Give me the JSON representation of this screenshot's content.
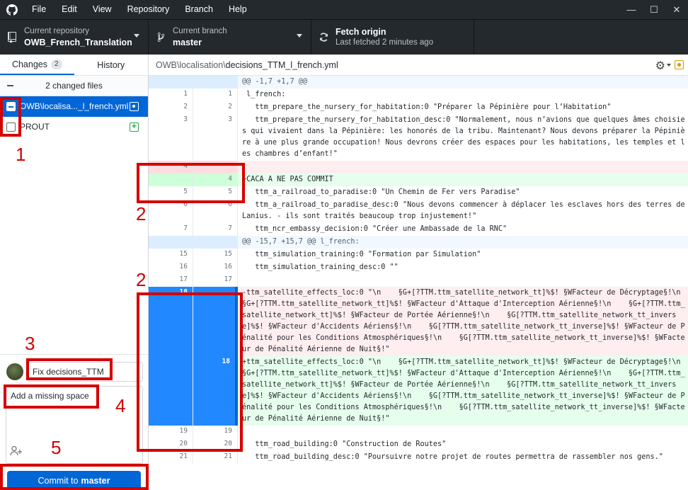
{
  "menu": [
    "File",
    "Edit",
    "View",
    "Repository",
    "Branch",
    "Help"
  ],
  "window_controls": {
    "minimize": "—",
    "maximize": "☐",
    "close": "✕"
  },
  "toolbar": {
    "repo_sub": "Current repository",
    "repo_main": "OWB_French_Translation",
    "branch_sub": "Current branch",
    "branch_main": "master",
    "fetch_main": "Fetch origin",
    "fetch_sub": "Last fetched 2 minutes ago"
  },
  "tabs": {
    "changes": "Changes",
    "changes_count": "2",
    "history": "History"
  },
  "changed_files_label": "2 changed files",
  "files": [
    {
      "name": "OWB\\localisa..._l_french.yml",
      "checked": "partial",
      "status": "modified"
    },
    {
      "name": "PROUT",
      "checked": "unchecked",
      "status": "added"
    }
  ],
  "commit": {
    "summary": "Fix decisions_TTM",
    "description": "Add a missing space",
    "button_prefix": "Commit to",
    "button_branch": "master"
  },
  "path": {
    "dir": "OWB\\localisation\\",
    "file": "decisions_TTM_l_french.yml"
  },
  "diff": [
    {
      "type": "hunk",
      "old": "",
      "new": "",
      "text": "@@ -1,7 +1,7 @@"
    },
    {
      "type": "ctx",
      "old": "1",
      "new": "1",
      "text": " l_french:"
    },
    {
      "type": "ctx",
      "old": "2",
      "new": "2",
      "text": "   ttm_prepare_the_nursery_for_habitation:0 \"Préparer la Pépinière pour l’Habitation\""
    },
    {
      "type": "ctx",
      "old": "3",
      "new": "3",
      "text": "   ttm_prepare_the_nursery_for_habitation_desc:0 \"Normalement, nous n’avions que quelques âmes choisies qui vivaient dans la Pépinière: les honorés de la tribu. Maintenant? Nous devons préparer la Pépinière à une plus grande occupation! Nous devrons créer des espaces pour les habitations, les temples et les chambres d’enfant!\""
    },
    {
      "type": "del",
      "old": "4",
      "new": "",
      "text": ""
    },
    {
      "type": "add",
      "old": "",
      "new": "4",
      "text": "+CACA A NE PAS COMMIT"
    },
    {
      "type": "ctx",
      "old": "5",
      "new": "5",
      "text": "   ttm_a_railroad_to_paradise:0 \"Un Chemin de Fer vers Paradise\""
    },
    {
      "type": "ctx",
      "old": "6",
      "new": "6",
      "text": "   ttm_a_railroad_to_paradise_desc:0 \"Nous devons commencer à déplacer les esclaves hors des terres de Lanius. - ils sont traités beaucoup trop injustement!\""
    },
    {
      "type": "ctx",
      "old": "7",
      "new": "7",
      "text": "   ttm_ncr_embassy_decision:0 \"Créer une Ambassade de la RNC\""
    },
    {
      "type": "hunk",
      "old": "",
      "new": "",
      "text": "@@ -15,7 +15,7 @@ l_french:"
    },
    {
      "type": "ctx",
      "old": "15",
      "new": "15",
      "text": "   ttm_simulation_training:0 \"Formation par Simulation\""
    },
    {
      "type": "ctx",
      "old": "16",
      "new": "16",
      "text": "   ttm_simulation_training_desc:0 \"\""
    },
    {
      "type": "ctx",
      "old": "17",
      "new": "17",
      "text": ""
    },
    {
      "type": "del sel",
      "old": "18",
      "new": "",
      "text": "-ttm_satellite_effects_loc:0 \"\\n    §G+[?TTM.ttm_satellite_network_tt]%$! §WFacteur de Décryptage§!\\n    §G+[?TTM.ttm_satellite_network_tt]%$! §WFacteur d'Attaque d'Interception Aérienne§!\\n    §G+[?TTM.ttm_satellite_network_tt]%$! §WFacteur de Portée Aérienne§!\\n    §G[?TTM.ttm_satellite_network_tt_inverse]%$! §WFacteur d'Accidents Aériens§!\\n    §G[?TTM.ttm_satellite_network_tt_inverse]%$! §WFacteur de Pénalité pour les Conditions Atmosphériques§!\\n    §G[?TTM.ttm_satellite_network_tt_inverse]%$! §WFacteur de Pénalité Aérienne de Nuit§!\""
    },
    {
      "type": "add sel",
      "old": "",
      "new": "18",
      "text": "+ttm_satellite_effects_loc:0 \"\\n    §G+[?TTM.ttm_satellite_network_tt]%$! §WFacteur de Décryptage§!\\n    §G+[?TTM.ttm_satellite_network_tt]%$! §WFacteur d'Attaque d'Interception Aérienne§!\\n    §G+[?TTM.ttm_satellite_network_tt]%$! §WFacteur de Portée Aérienne§!\\n    §G[?TTM.ttm_satellite_network_tt_inverse]%$! §WFacteur d'Accidents Aériens§!\\n    §G[?TTM.ttm_satellite_network_tt_inverse]%$! §WFacteur de Pénalité pour les Conditions Atmosphériques§!\\n    §G[?TTM.ttm_satellite_network_tt_inverse]%$! §WFacteur de Pénalité Aérienne de Nuit§!\""
    },
    {
      "type": "ctx",
      "old": "19",
      "new": "19",
      "text": ""
    },
    {
      "type": "ctx",
      "old": "20",
      "new": "20",
      "text": "   ttm_road_building:0 \"Construction de Routes\""
    },
    {
      "type": "ctx",
      "old": "21",
      "new": "21",
      "text": "   ttm_road_building_desc:0 \"Poursuivre notre projet de routes permettra de rassembler nos gens.\""
    }
  ],
  "annotations": [
    "1",
    "2",
    "2",
    "3",
    "4",
    "5"
  ],
  "colors": {
    "accent": "#0366d6",
    "annotation": "#d50000",
    "added": "#28a745",
    "modified": "#d29a00"
  }
}
